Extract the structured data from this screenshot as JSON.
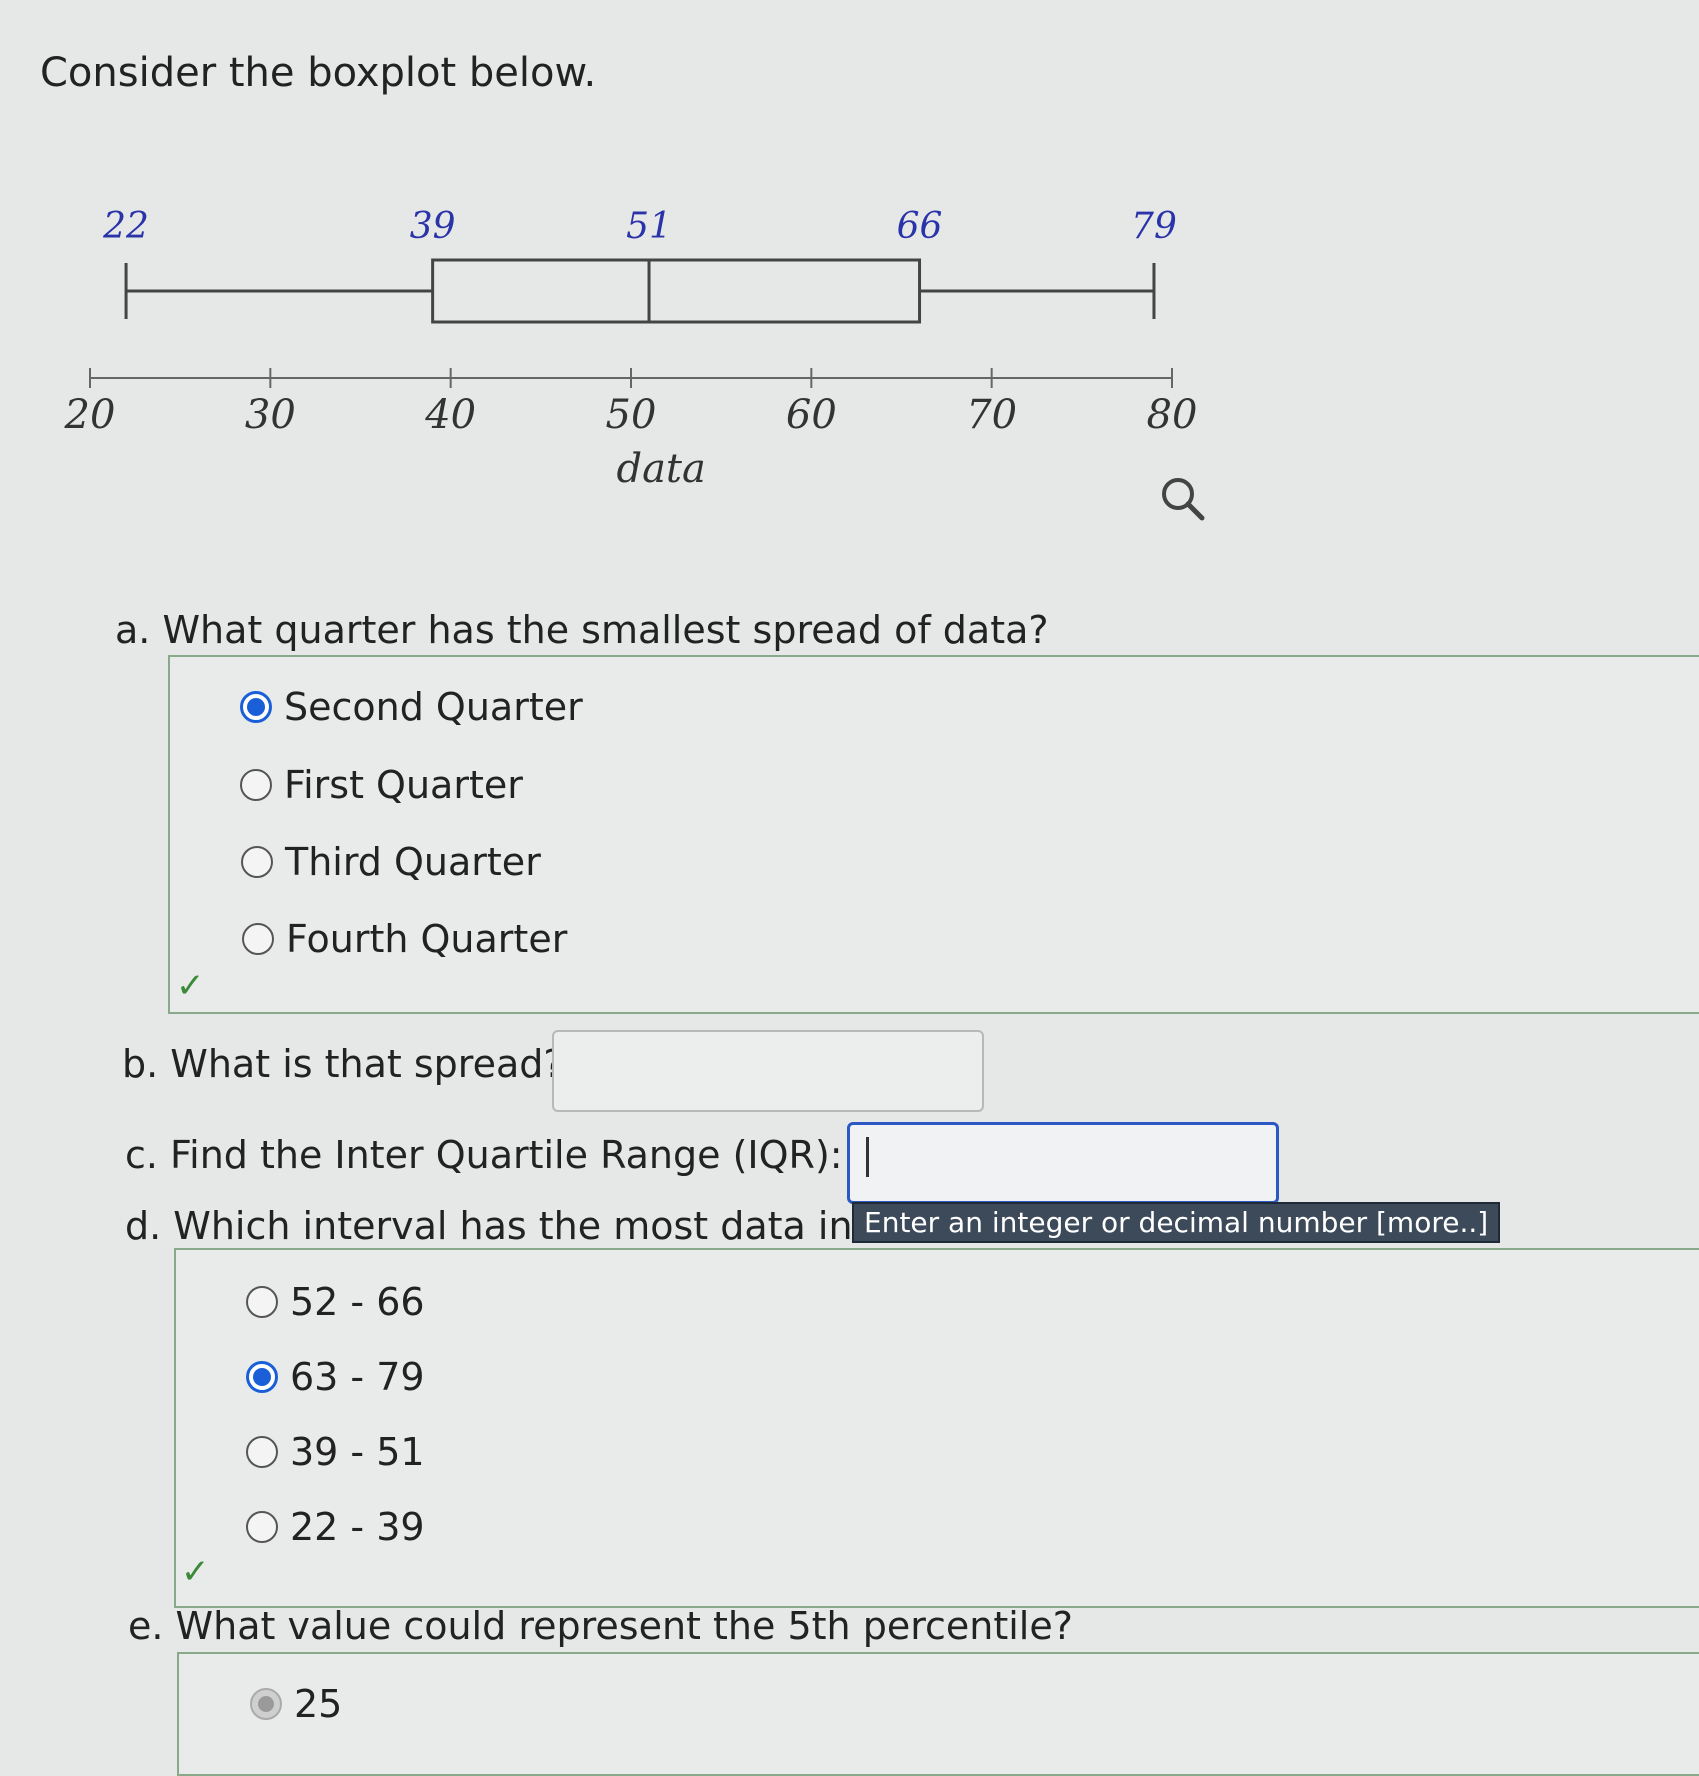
{
  "title": "Consider the boxplot below.",
  "chart_data": {
    "type": "boxplot",
    "xlabel": "data",
    "xlim": [
      20,
      80
    ],
    "ticks": [
      20,
      30,
      40,
      50,
      60,
      70,
      80
    ],
    "min": 22,
    "q1": 39,
    "median": 51,
    "q3": 66,
    "max": 79,
    "labels": [
      "22",
      "39",
      "51",
      "66",
      "79"
    ]
  },
  "questions": {
    "a": {
      "prompt": "a. What quarter has the smallest spread of data?",
      "options": [
        "Second Quarter",
        "First Quarter",
        "Third Quarter",
        "Fourth Quarter"
      ],
      "selected": 0
    },
    "b": {
      "prompt": "b. What is that spread?",
      "value": ""
    },
    "c": {
      "prompt": "c. Find the Inter Quartile Range (IQR):",
      "value": ""
    },
    "tooltip": "Enter an integer or decimal number [more..]",
    "d": {
      "prompt": "d. Which interval has the most data in it?",
      "options": [
        "52 - 66",
        "63 - 79",
        "39 - 51",
        "22 - 39"
      ],
      "selected": 1
    },
    "e": {
      "prompt": "e. What value could represent the 5th percentile?",
      "options": [
        "25"
      ]
    }
  }
}
